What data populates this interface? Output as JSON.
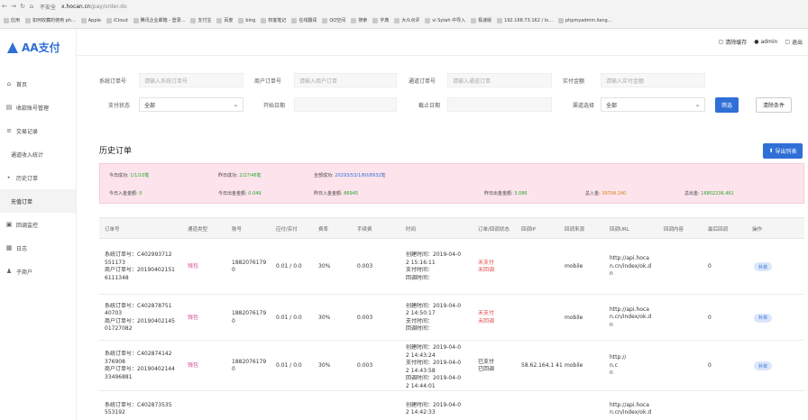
{
  "browser": {
    "security": "不安全",
    "domain": "x.hocan.cn",
    "path": "/pay/order.do",
    "bookmarks": [
      "应用",
      "如何收藏的使用 ph...",
      "Apple",
      "iCloud",
      "腾讯企业邮箱 - 登录...",
      "支付宝",
      "百度",
      "bing",
      "权客笔记",
      "在线翻译",
      "QQ空间",
      "搜索",
      "字典",
      "大众点评",
      "vi Sytah 中导入",
      "极速版",
      "192.168.73.162 / lo...",
      "phpmyadmin.liang..."
    ]
  },
  "app": {
    "name": "AA支付",
    "header_links": [
      "清除缓存",
      "admin",
      "退出"
    ]
  },
  "sidebar": {
    "items": [
      {
        "label": "首页",
        "icon": "home-icon"
      },
      {
        "label": "收款账号管理",
        "icon": "doc-icon"
      },
      {
        "label": "交易记录",
        "icon": "list-icon"
      },
      {
        "label": "通道收入统计",
        "icon": ""
      },
      {
        "label": "历史订单",
        "icon": "caret-icon"
      },
      {
        "label": "充值订单",
        "icon": ""
      },
      {
        "label": "回调监控",
        "icon": "monitor-icon"
      },
      {
        "label": "日志",
        "icon": "log-icon"
      },
      {
        "label": "子商户",
        "icon": "user-icon"
      }
    ]
  },
  "filters": {
    "system_order_label": "系统订单号",
    "system_order_placeholder": "请输入系统订单号",
    "merchant_order_label": "商户订单号",
    "merchant_order_placeholder": "请输入商户订单",
    "upstream_order_label": "通道订单号",
    "upstream_order_placeholder": "请输入通道订单",
    "amount_label": "实付金额",
    "amount_placeholder": "请输入实付金额",
    "status_label": "支付状态",
    "status_value": "全部",
    "start_label": "开始日期",
    "end_label": "截止日期",
    "channel_label": "渠道选择",
    "channel_value": "全部",
    "search_label": "筛选",
    "clear_label": "清除条件"
  },
  "section": {
    "title": "历史订单",
    "export_label": "导出列表"
  },
  "stats": {
    "row1": [
      {
        "label": "今日成功:",
        "value": "1/1/10笔"
      },
      {
        "label": "昨日成功:",
        "value": "2/27/46笔"
      },
      {
        "label": "全部成功:",
        "value": "20293/53/1/60/8932笔"
      }
    ],
    "row2": [
      {
        "label": "今日入金金额:",
        "value": "0"
      },
      {
        "label": "今日出金金额:",
        "value": "0.049"
      },
      {
        "label": "昨日入金金额:",
        "value": "86945"
      },
      {
        "label": "昨日出金金额:",
        "value": "3.086"
      },
      {
        "label": "总入金:",
        "value": "39704.240"
      },
      {
        "label": "总出金:",
        "value": "16802236.461"
      }
    ]
  },
  "table": {
    "headers": [
      "订单号",
      "通道类型",
      "账号",
      "应付/实付",
      "费率",
      "手续费",
      "时间",
      "订单/回调状态",
      "回调IP",
      "回调来源",
      "回调URL",
      "回调内容",
      "最后回调",
      "操作"
    ],
    "rows": [
      {
        "order_lines": [
          "系统订单号：C402993712",
          "551173",
          "商户订单号：20190402151",
          "6111348"
        ],
        "channel": "钱包",
        "account_lines": [
          "1882076179",
          "0"
        ],
        "amount": "0.01 / 0.0",
        "rate": "30%",
        "fee": "0.003",
        "time_lines": [
          "创建时间：2019-04-0",
          "2 15:16:11",
          "支付时间：",
          "回调时间："
        ],
        "status_lines": [
          "未支付",
          "未回调"
        ],
        "ip": "",
        "source": "mobile",
        "url_lines": [
          "http://api.hoca",
          "n.cn/index/ok.d",
          "n"
        ],
        "content": "",
        "last": "0",
        "action": "补单"
      },
      {
        "order_lines": [
          "系统订单号：C402878751",
          "40703",
          "商户订单号：20190402145",
          "01727082"
        ],
        "channel": "钱包",
        "account_lines": [
          "1882076179",
          "0"
        ],
        "amount": "0.01 / 0.0",
        "rate": "30%",
        "fee": "0.003",
        "time_lines": [
          "创建时间：2019-04-0",
          "2 14:50:17",
          "支付时间：",
          "回调时间："
        ],
        "status_lines": [
          "未支付",
          "未回调"
        ],
        "ip": "",
        "source": "mobile",
        "url_lines": [
          "http://api.hoca",
          "n.cn/index/ok.d",
          "n"
        ],
        "content": "",
        "last": "0",
        "action": "补单"
      },
      {
        "order_lines": [
          "系统订单号：C402874142",
          "376908",
          "商户订单号：20190402144",
          "33496881"
        ],
        "channel": "钱包",
        "account_lines": [
          "1882076179",
          "0"
        ],
        "amount": "0.01 / 0.0",
        "rate": "30%",
        "fee": "0.003",
        "time_lines": [
          "创建时间：2019-04-0",
          "2 14:43:24",
          "支付时间：2019-04-0",
          "2 14:43:58",
          "回调时间：2019-04-0",
          "2 14:44:01"
        ],
        "status_lines": [
          "已支付",
          "已回调"
        ],
        "ip": "58.62.164.1 41",
        "source": "mobile",
        "url_lines": [
          "http://",
          "n.c",
          "n"
        ],
        "content": "",
        "last": "0",
        "action": "补单"
      },
      {
        "order_lines": [
          "系统订单号：C402873535",
          "553192"
        ],
        "channel": "",
        "account_lines": [],
        "amount": "",
        "rate": "",
        "fee": "",
        "time_lines": [
          "创建时间：2019-04-0",
          "2 14:42:33"
        ],
        "status_lines": [],
        "ip": "",
        "source": "",
        "url_lines": [
          "http://api.hoca",
          "n.cn/index/ok.d"
        ],
        "content": "",
        "last": "",
        "action": ""
      }
    ]
  }
}
